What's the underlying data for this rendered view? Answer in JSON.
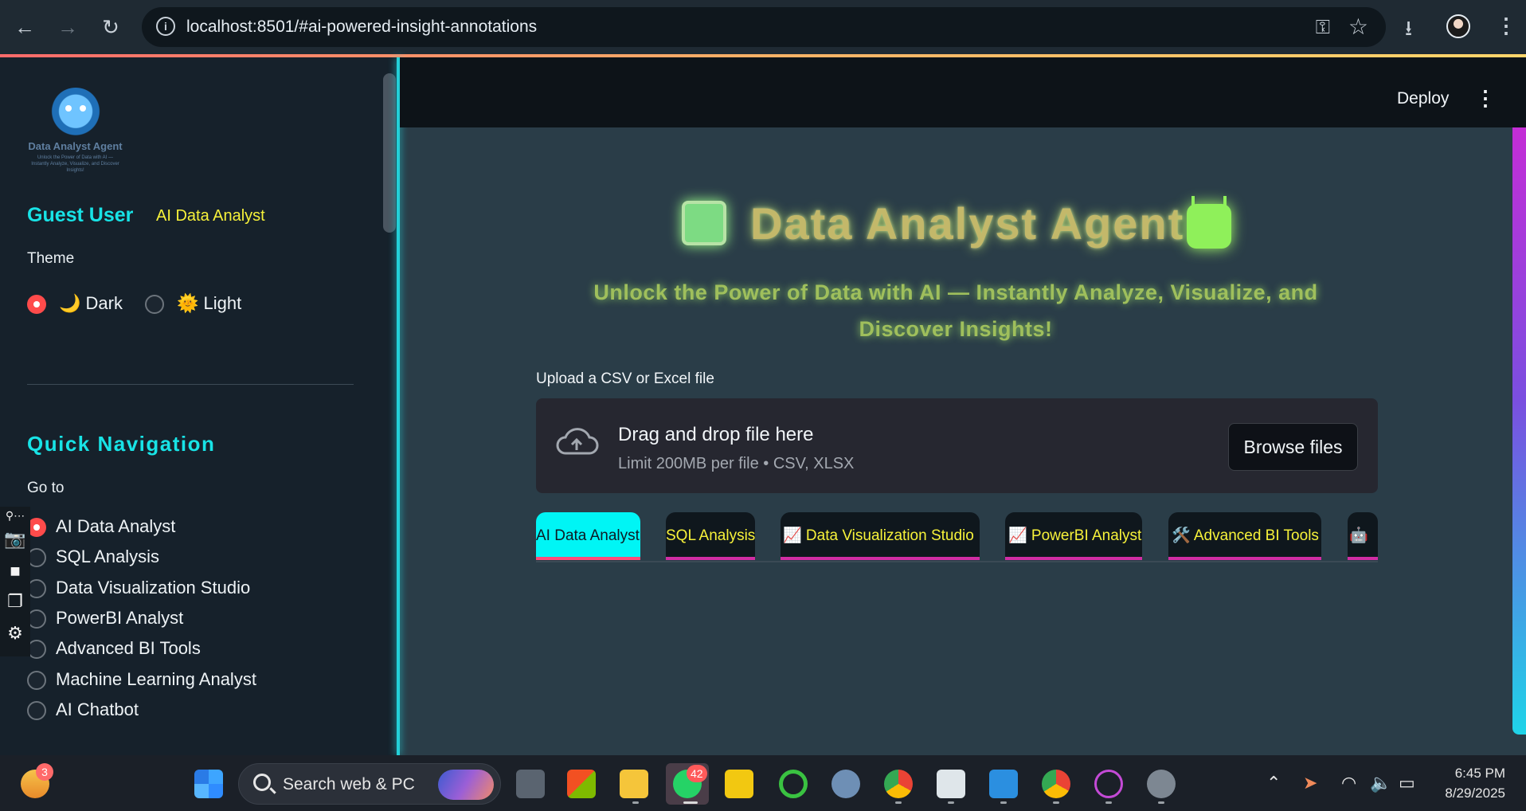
{
  "browser": {
    "url": "localhost:8501/#ai-powered-insight-annotations"
  },
  "sidebar": {
    "logo_title": "Data Analyst Agent",
    "logo_subtitle": "Unlock the Power of Data with AI — Instantly Analyze, Visualize, and Discover Insights!",
    "user_name": "Guest User",
    "user_role": "AI Data Analyst",
    "theme_label": "Theme",
    "theme_options": [
      {
        "emoji": "🌙",
        "label": "Dark",
        "selected": true
      },
      {
        "emoji": "🌞",
        "label": "Light",
        "selected": false
      }
    ],
    "quick_nav_title": "Quick Navigation",
    "goto_label": "Go to",
    "nav_options": [
      {
        "label": "AI Data Analyst",
        "selected": true
      },
      {
        "label": "SQL Analysis",
        "selected": false
      },
      {
        "label": "Data Visualization Studio",
        "selected": false
      },
      {
        "label": "PowerBI Analyst",
        "selected": false
      },
      {
        "label": "Advanced BI Tools",
        "selected": false
      },
      {
        "label": "Machine Learning Analyst",
        "selected": false
      },
      {
        "label": "AI Chatbot",
        "selected": false
      }
    ]
  },
  "topbar": {
    "deploy_label": "Deploy",
    "menu_icon": "kebab-menu-icon"
  },
  "hero": {
    "title": "Data Analyst Agent",
    "subtitle": "Unlock the Power of Data with AI — Instantly Analyze, Visualize, and Discover Insights!"
  },
  "uploader": {
    "label": "Upload a CSV or Excel file",
    "drop_title": "Drag and drop file here",
    "drop_sub": "Limit 200MB per file • CSV, XLSX",
    "browse_label": "Browse files"
  },
  "tabs": [
    {
      "label": "AI Data Analyst",
      "active": true
    },
    {
      "label": "SQL Analysis",
      "active": false
    },
    {
      "label": "📈 Data Visualization Studio",
      "active": false
    },
    {
      "label": "📈 PowerBI Analyst",
      "active": false
    },
    {
      "label": "🛠️ Advanced BI Tools",
      "active": false
    },
    {
      "label": "🤖",
      "active": false
    }
  ],
  "taskbar": {
    "weather_badge": "3",
    "search_placeholder": "Search web & PC",
    "whatsapp_badge": "42",
    "time": "6:45 PM",
    "date": "8/29/2025"
  },
  "colors": {
    "accent_cyan": "#18e3e6",
    "accent_yellow": "#f7f23a",
    "radio_red": "#ff4b4b"
  }
}
